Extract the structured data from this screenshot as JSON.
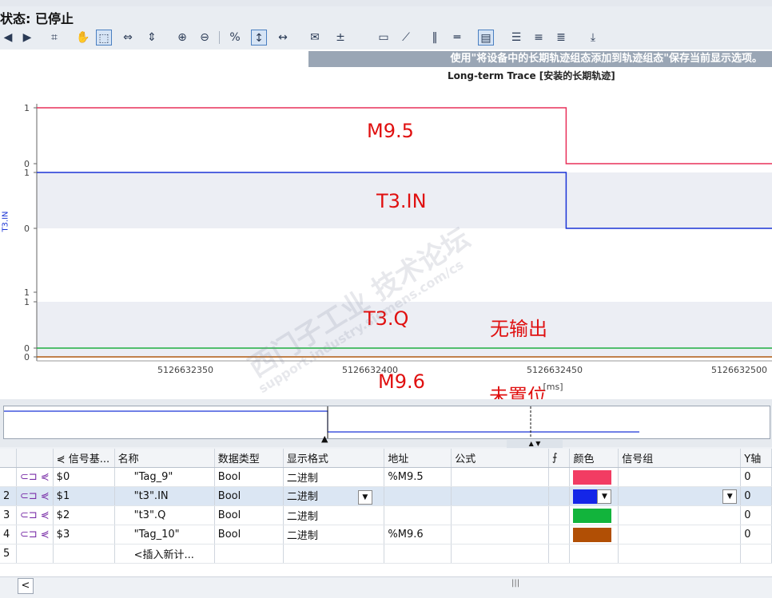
{
  "status": {
    "text": "状态: 已停止"
  },
  "banner": {
    "text": "使用\"将设备中的长期轨迹组态添加到轨迹组态\"保存当前显示选项。"
  },
  "chart_title": "Long-term Trace [安装的长期轨迹]",
  "axis_side_label": "T3.IN",
  "annotations": {
    "m95": "M9.5",
    "t3in": "T3.IN",
    "t3q": "T3.Q",
    "no_output": "无输出",
    "m96": "M9.6",
    "not_set": "未置位"
  },
  "watermark": {
    "line1": "西门子工业 技术论坛",
    "line2": "support.industry.siemens.com/cs"
  },
  "chart_data": {
    "type": "line",
    "x_ticks": [
      "5126632350",
      "5126632400",
      "5126632450",
      "5126632500"
    ],
    "x_partial_label": "[ms]",
    "colors": {
      "m95": "#e8305a",
      "t3in": "#1b34d6",
      "t3q": "#1fae40",
      "m96": "#b05a10"
    },
    "series": [
      {
        "name": "M9.5",
        "lanes_ticks": [
          "1",
          "0"
        ],
        "values": [
          [
            0,
            1
          ],
          [
            0.72,
            1
          ],
          [
            0.72,
            0
          ],
          [
            1,
            0
          ]
        ]
      },
      {
        "name": "T3.IN",
        "lanes_ticks": [
          "1",
          "0"
        ],
        "values": [
          [
            0,
            1
          ],
          [
            0.72,
            1
          ],
          [
            0.72,
            0
          ],
          [
            1,
            0
          ]
        ]
      },
      {
        "name": "T3.Q",
        "lanes_ticks": [
          "1",
          "0"
        ],
        "values": [
          [
            0,
            0
          ],
          [
            1,
            0
          ]
        ]
      },
      {
        "name": "M9.6",
        "lanes_ticks": [
          "1",
          "0"
        ],
        "values": [
          [
            0,
            0
          ],
          [
            1,
            0
          ]
        ]
      }
    ]
  },
  "table": {
    "headers": [
      "",
      "",
      "信号基...",
      "名称",
      "数据类型",
      "显示格式",
      "地址",
      "公式",
      "",
      "颜色",
      "信号组",
      "Y轴"
    ],
    "rows": [
      {
        "num": "",
        "id": "$0",
        "name": "\"Tag_9\"",
        "type": "Bool",
        "format": "二进制",
        "addr": "%M9.5",
        "color": "#f23c63",
        "y": "0"
      },
      {
        "num": "2",
        "id": "$1",
        "name": "\"t3\".IN",
        "type": "Bool",
        "format": "二进制",
        "addr": "",
        "color": "#1426e8",
        "y": "0"
      },
      {
        "num": "3",
        "id": "$2",
        "name": "\"t3\".Q",
        "type": "Bool",
        "format": "二进制",
        "addr": "",
        "color": "#12b43c",
        "y": "0"
      },
      {
        "num": "4",
        "id": "$3",
        "name": "\"Tag_10\"",
        "type": "Bool",
        "format": "二进制",
        "addr": "%M9.6",
        "color": "#b14f05",
        "y": "0"
      },
      {
        "num": "5",
        "id": "",
        "name": "<插入新计...",
        "type": "",
        "format": "",
        "addr": "",
        "color": "",
        "y": ""
      }
    ]
  },
  "scroll": {
    "left": "<",
    "thumb": "|||"
  }
}
